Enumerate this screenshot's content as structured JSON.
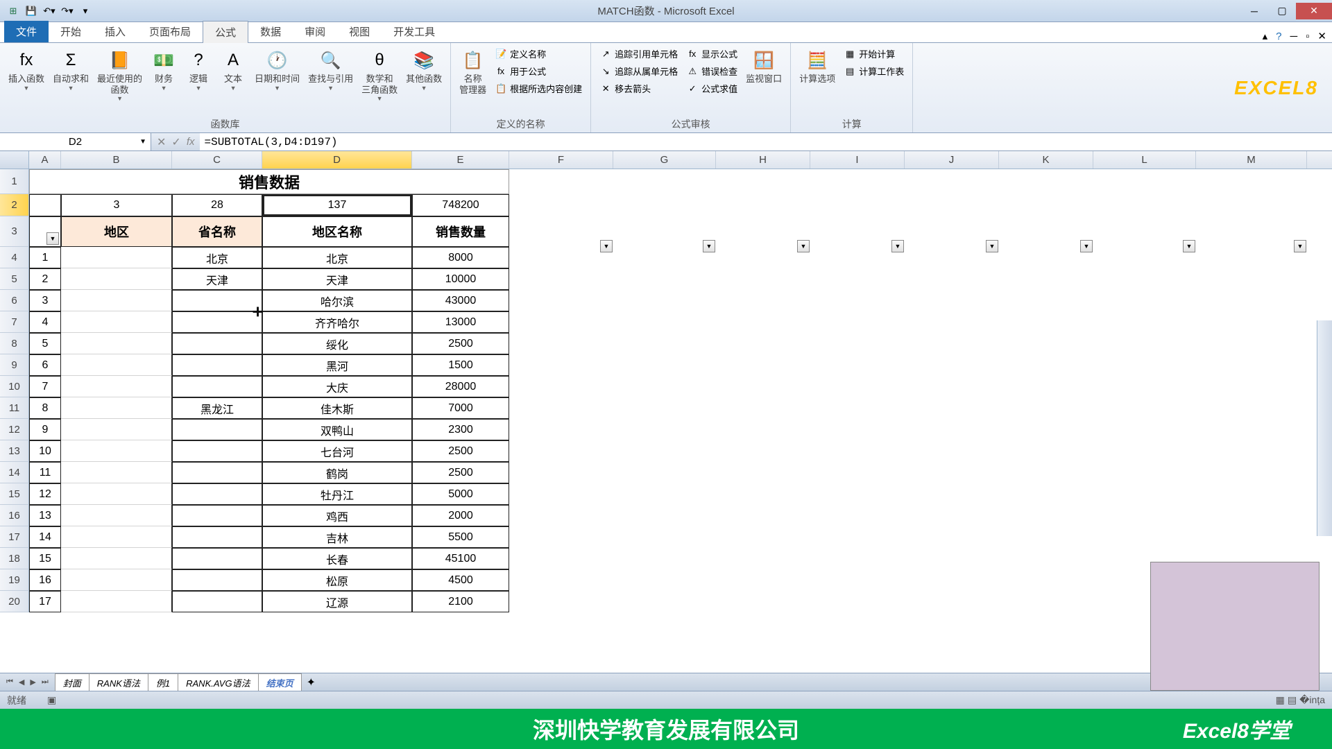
{
  "title": "MATCH函数 - Microsoft Excel",
  "qat": [
    "excel-icon",
    "save-icon",
    "undo-icon",
    "redo-icon"
  ],
  "tabs": {
    "file": "文件",
    "list": [
      "开始",
      "插入",
      "页面布局",
      "公式",
      "数据",
      "审阅",
      "视图",
      "开发工具"
    ],
    "active": "公式"
  },
  "ribbon": {
    "g1": {
      "label": "函数库",
      "btns": [
        {
          "icon": "fx",
          "label": "插入函数"
        },
        {
          "icon": "Σ",
          "label": "自动求和"
        },
        {
          "icon": "📙",
          "label": "最近使用的\n函数"
        },
        {
          "icon": "💵",
          "label": "财务"
        },
        {
          "icon": "?",
          "label": "逻辑"
        },
        {
          "icon": "A",
          "label": "文本"
        },
        {
          "icon": "🕐",
          "label": "日期和时间"
        },
        {
          "icon": "🔍",
          "label": "查找与引用"
        },
        {
          "icon": "θ",
          "label": "数学和\n三角函数"
        },
        {
          "icon": "📚",
          "label": "其他函数"
        }
      ]
    },
    "g2": {
      "label": "定义的名称",
      "main": {
        "icon": "📋",
        "label": "名称\n管理器"
      },
      "small": [
        "定义名称",
        "用于公式",
        "根据所选内容创建"
      ]
    },
    "g3": {
      "label": "公式审核",
      "small1": [
        "追踪引用单元格",
        "追踪从属单元格",
        "移去箭头"
      ],
      "small2": [
        "显示公式",
        "错误检查",
        "公式求值"
      ],
      "main": {
        "icon": "🪟",
        "label": "监视窗口"
      }
    },
    "g4": {
      "label": "计算",
      "main": {
        "icon": "🧮",
        "label": "计算选项"
      },
      "small": [
        "开始计算",
        "计算工作表"
      ]
    }
  },
  "logo": "EXCEL8",
  "namebox": "D2",
  "formula": "=SUBTOTAL(3,D4:D197)",
  "columns": [
    "A",
    "B",
    "C",
    "D",
    "E",
    "F",
    "G",
    "H",
    "I",
    "J",
    "K",
    "L",
    "M"
  ],
  "rows": [
    "1",
    "2",
    "3",
    "4",
    "5",
    "6",
    "7",
    "8",
    "9",
    "10",
    "11",
    "12",
    "13",
    "14",
    "15",
    "16",
    "17",
    "18",
    "19",
    "20"
  ],
  "title_cell": "销售数据",
  "row2": {
    "B": "3",
    "C": "28",
    "D": "137",
    "E": "748200"
  },
  "headers": {
    "B": "地区",
    "C": "省名称",
    "D": "地区名称",
    "E": "销售数量"
  },
  "data": [
    {
      "a": "1",
      "c": "北京",
      "d": "北京",
      "e": "8000"
    },
    {
      "a": "2",
      "c": "天津",
      "d": "天津",
      "e": "10000"
    },
    {
      "a": "3",
      "c": "",
      "d": "哈尔滨",
      "e": "43000"
    },
    {
      "a": "4",
      "c": "",
      "d": "齐齐哈尔",
      "e": "13000"
    },
    {
      "a": "5",
      "c": "",
      "d": "绥化",
      "e": "2500"
    },
    {
      "a": "6",
      "c": "",
      "d": "黑河",
      "e": "1500"
    },
    {
      "a": "7",
      "c": "",
      "d": "大庆",
      "e": "28000"
    },
    {
      "a": "8",
      "c": "黑龙江",
      "d": "佳木斯",
      "e": "7000"
    },
    {
      "a": "9",
      "c": "",
      "d": "双鸭山",
      "e": "2300"
    },
    {
      "a": "10",
      "c": "",
      "d": "七台河",
      "e": "2500"
    },
    {
      "a": "11",
      "c": "",
      "d": "鹤岗",
      "e": "2500"
    },
    {
      "a": "12",
      "c": "",
      "d": "牡丹江",
      "e": "5000"
    },
    {
      "a": "13",
      "c": "",
      "d": "鸡西",
      "e": "2000"
    },
    {
      "a": "14",
      "c": "",
      "d": "吉林",
      "e": "5500"
    },
    {
      "a": "15",
      "c": "",
      "d": "长春",
      "e": "45100"
    },
    {
      "a": "16",
      "c": "",
      "d": "松原",
      "e": "4500"
    },
    {
      "a": "17",
      "c": "",
      "d": "辽源",
      "e": "2100"
    }
  ],
  "merged_c": "黑龙江",
  "sheets": [
    "封面",
    "RANK语法",
    "例1",
    "RANK.AVG语法",
    "结束页"
  ],
  "sheet_active": "结束页",
  "status": "就绪",
  "footer": "深圳快学教育发展有限公司",
  "footer_right": "Excel8学堂"
}
